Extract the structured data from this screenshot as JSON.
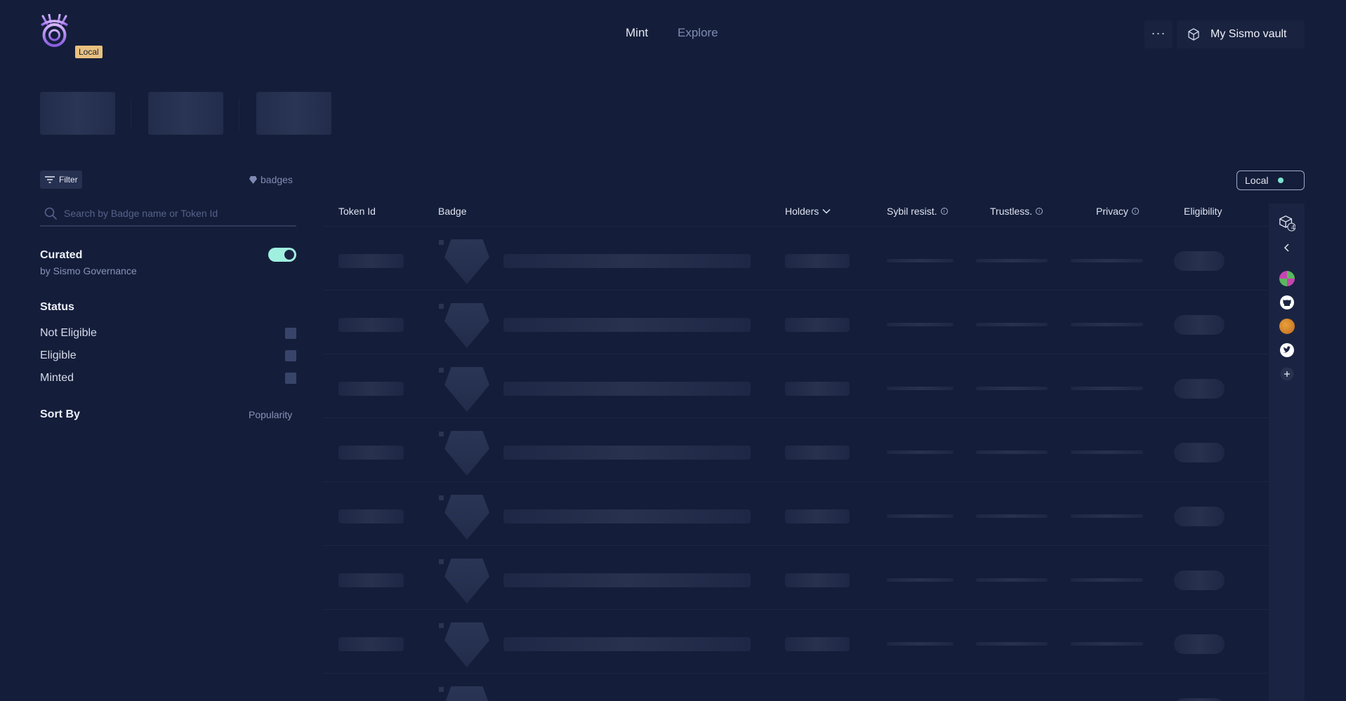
{
  "header": {
    "env_badge": "Local",
    "nav": [
      {
        "label": "Mint",
        "active": true
      },
      {
        "label": "Explore",
        "active": false
      }
    ],
    "more_label": "···",
    "vault_label": "My Sismo vault"
  },
  "sidebar": {
    "filter_label": "Filter",
    "badges_label": "badges",
    "search_placeholder": "Search by Badge name or Token Id",
    "curated": {
      "title": "Curated",
      "subtitle": "by Sismo Governance",
      "enabled": true
    },
    "status": {
      "title": "Status",
      "options": [
        {
          "label": "Not Eligible",
          "checked": false
        },
        {
          "label": "Eligible",
          "checked": false
        },
        {
          "label": "Minted",
          "checked": false
        }
      ]
    },
    "sort": {
      "title": "Sort By",
      "value": "Popularity"
    }
  },
  "table": {
    "network_chip": "Local",
    "columns": {
      "token_id": "Token Id",
      "badge": "Badge",
      "holders": "Holders",
      "sybil": "Sybil resist.",
      "trustless": "Trustless.",
      "privacy": "Privacy",
      "eligibility": "Eligibility"
    },
    "loading_rows": 8
  },
  "rail": {
    "vault_count": "4",
    "accounts": [
      "avatar-1",
      "github-icon",
      "avatar-2",
      "twitter-icon"
    ]
  },
  "colors": {
    "background": "#141e3a",
    "toggle_on": "#a0f0e0",
    "env_badge": "#e8c17f",
    "status_dot": "#7de3d0",
    "logo": "#b48bf0"
  }
}
